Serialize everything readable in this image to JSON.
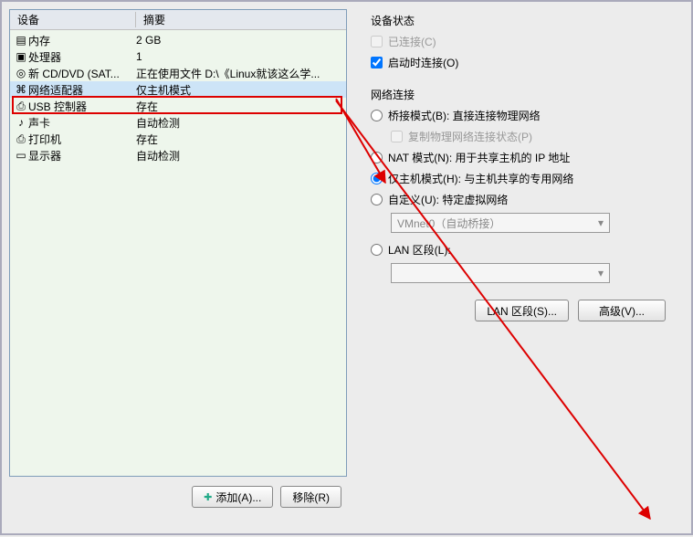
{
  "columns": {
    "device": "设备",
    "summary": "摘要"
  },
  "rows": [
    {
      "icon": "memory-icon",
      "name": "内存",
      "summary": "2 GB"
    },
    {
      "icon": "cpu-icon",
      "name": "处理器",
      "summary": "1"
    },
    {
      "icon": "cd-icon",
      "name": "新 CD/DVD (SAT...",
      "summary": "正在使用文件 D:\\《Linux就该这么学..."
    },
    {
      "icon": "network-icon",
      "name": "网络适配器",
      "summary": "仅主机模式",
      "selected": true
    },
    {
      "icon": "usb-icon",
      "name": "USB 控制器",
      "summary": "存在"
    },
    {
      "icon": "sound-icon",
      "name": "声卡",
      "summary": "自动检测"
    },
    {
      "icon": "printer-icon",
      "name": "打印机",
      "summary": "存在"
    },
    {
      "icon": "display-icon",
      "name": "显示器",
      "summary": "自动检测"
    }
  ],
  "left_buttons": {
    "add": "添加(A)...",
    "remove": "移除(R)"
  },
  "status": {
    "title": "设备状态",
    "connected": "已连接(C)",
    "connect_at_power": "启动时连接(O)"
  },
  "network": {
    "title": "网络连接",
    "bridged": "桥接模式(B): 直接连接物理网络",
    "replicate": "复制物理网络连接状态(P)",
    "nat": "NAT 模式(N): 用于共享主机的 IP 地址",
    "hostonly": "仅主机模式(H): 与主机共享的专用网络",
    "custom": "自定义(U): 特定虚拟网络",
    "vmnet": "VMnet0（自动桥接）",
    "lan_segment": "LAN 区段(L):"
  },
  "right_buttons": {
    "lan": "LAN 区段(S)...",
    "adv": "高级(V)..."
  }
}
